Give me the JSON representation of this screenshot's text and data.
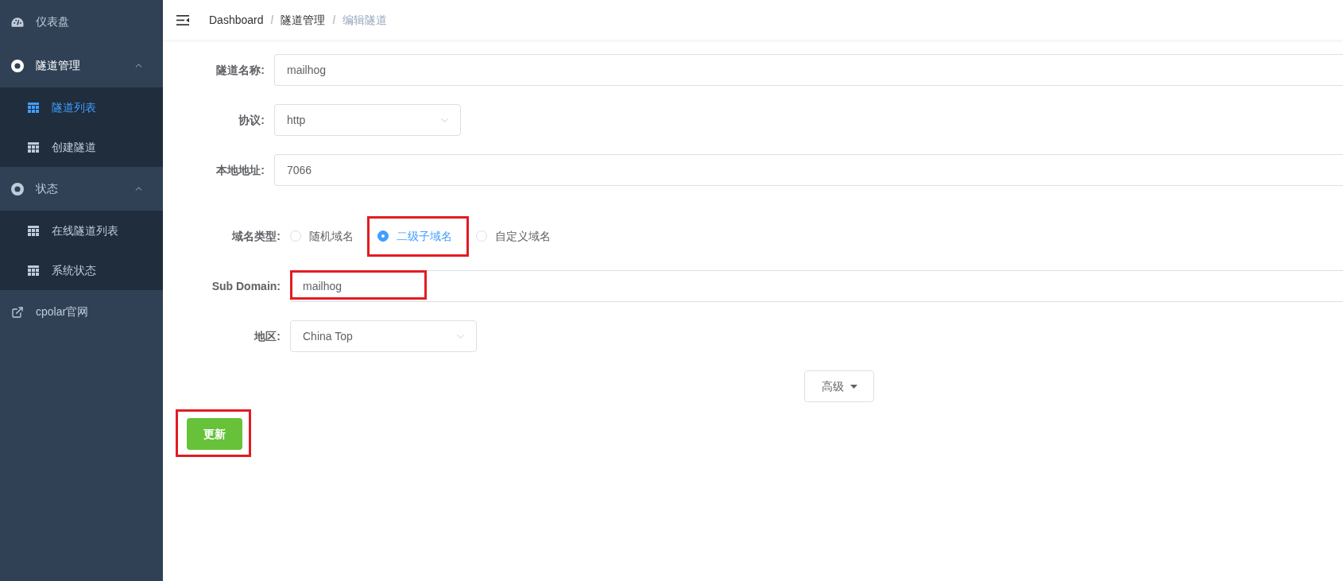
{
  "sidebar": {
    "items": [
      {
        "kind": "link",
        "label": "仪表盘"
      },
      {
        "kind": "group",
        "label": "隧道管理",
        "expanded": true,
        "children": [
          {
            "label": "隧道列表",
            "selected": true
          },
          {
            "label": "创建隧道",
            "selected": false
          }
        ]
      },
      {
        "kind": "group",
        "label": "状态",
        "expanded": true,
        "children": [
          {
            "label": "在线隧道列表",
            "selected": false
          },
          {
            "label": "系统状态",
            "selected": false
          }
        ]
      },
      {
        "kind": "external",
        "label": "cpolar官网"
      }
    ]
  },
  "header": {
    "breadcrumb": [
      {
        "label": "Dashboard",
        "current": false
      },
      {
        "separator": "/",
        "label": "隧道管理",
        "current": false
      },
      {
        "separator": "/",
        "label": "编辑隧道",
        "current": true
      }
    ]
  },
  "form": {
    "sections": [
      {
        "fields": [
          {
            "kind": "input",
            "label": "隧道名称:",
            "value": "mailhog"
          },
          {
            "kind": "select",
            "label": "协议:",
            "value": "http"
          },
          {
            "kind": "input",
            "label": "本地地址:",
            "value": "7066"
          }
        ]
      },
      {
        "fields": [
          {
            "kind": "radio",
            "label": "域名类型:",
            "options": [
              {
                "label": "随机域名",
                "selected": false,
                "highlighted": false
              },
              {
                "label": "二级子域名",
                "selected": true,
                "highlighted": true
              },
              {
                "label": "自定义域名",
                "selected": false,
                "highlighted": false
              }
            ]
          },
          {
            "kind": "input",
            "label": "Sub Domain:",
            "value": "mailhog",
            "highlighted": true
          },
          {
            "kind": "select",
            "label": "地区:",
            "value": "China Top"
          }
        ]
      }
    ],
    "advanced_button": {
      "label": "高级"
    },
    "submit_button": {
      "label": "更新",
      "highlighted": true
    }
  }
}
